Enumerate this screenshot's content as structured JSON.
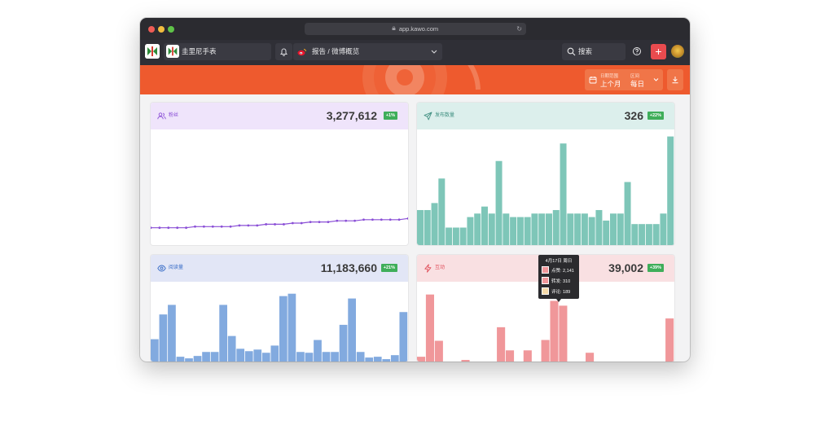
{
  "browser": {
    "url": "app.kawo.com",
    "lights": [
      "#ee5c55",
      "#f2bd3f",
      "#5fc348"
    ]
  },
  "nav": {
    "account_name": "圭里尼手表",
    "report_label": "报告 / 微博概览",
    "search_label": "搜索",
    "plus_label": "+"
  },
  "banner": {
    "date_range_caption": "日期范围",
    "date_range_value": "上个月",
    "interval_caption": "区间",
    "interval_value": "每日"
  },
  "cards": {
    "followers": {
      "label": "粉丝",
      "value": "3,277,612",
      "change": "+1%",
      "color": "#8a4fd6",
      "bg": "#efe4fb",
      "icon": "users-icon"
    },
    "posts": {
      "label": "发布数量",
      "value": "326",
      "change": "+22%",
      "color": "#3f8f80",
      "bg": "#dcefec",
      "icon": "send-icon"
    },
    "views": {
      "label": "阅读量",
      "value": "11,183,660",
      "change": "+21%",
      "color": "#3b6fc8",
      "bg": "#e2e6f6",
      "icon": "eye-icon"
    },
    "engagement": {
      "label": "互动",
      "value": "39,002",
      "change": "+39%",
      "color": "#e04e5a",
      "bg": "#f9e0e2",
      "icon": "bolt-icon"
    }
  },
  "tooltip": {
    "title": "4月17日 周日",
    "rows": [
      {
        "text": "点赞: 2,141",
        "color": "#f0979a"
      },
      {
        "text": "转发: 310",
        "color": "#f0979a"
      },
      {
        "text": "评论: 189",
        "color": "#f5d9a8"
      }
    ]
  },
  "chart_data": [
    {
      "type": "line",
      "series": [
        {
          "values": [
            0.15,
            0.15,
            0.15,
            0.15,
            0.15,
            0.16,
            0.16,
            0.16,
            0.16,
            0.16,
            0.17,
            0.17,
            0.17,
            0.18,
            0.18,
            0.18,
            0.19,
            0.19,
            0.2,
            0.2,
            0.2,
            0.21,
            0.21,
            0.21,
            0.22,
            0.22,
            0.22,
            0.22,
            0.22,
            0.23
          ],
          "color": "#8a4fd6"
        }
      ]
    },
    {
      "type": "bar",
      "series": [
        {
          "values": [
            10,
            10,
            12,
            19,
            5,
            5,
            5,
            8,
            9,
            11,
            9,
            24,
            9,
            8,
            8,
            8,
            9,
            9,
            9,
            10,
            29,
            9,
            9,
            9,
            8,
            10,
            7,
            9,
            9,
            18,
            6,
            6,
            6,
            6,
            9,
            31
          ],
          "color": "#7ec6b8"
        }
      ]
    },
    {
      "type": "bar",
      "series": [
        {
          "values": [
            0.28,
            0.59,
            0.71,
            0.06,
            0.04,
            0.07,
            0.12,
            0.12,
            0.71,
            0.32,
            0.16,
            0.13,
            0.15,
            0.11,
            0.2,
            0.82,
            0.85,
            0.12,
            0.11,
            0.27,
            0.12,
            0.12,
            0.46,
            0.79,
            0.12,
            0.05,
            0.06,
            0.03,
            0.08,
            0.62
          ],
          "color": "#82aadf"
        }
      ]
    },
    {
      "type": "bar",
      "series": [
        {
          "values": [
            0.06,
            0.84,
            0.26,
            0.0,
            0.0,
            0.02,
            0.0,
            0.0,
            0.0,
            0.43,
            0.14,
            0.0,
            0.14,
            0.0,
            0.27,
            0.76,
            0.7,
            0.0,
            0.0,
            0.11,
            0.0,
            0.0,
            0.0,
            0.0,
            0.0,
            0.0,
            0.0,
            0.0,
            0.54
          ],
          "color": "#f0979a"
        }
      ]
    }
  ]
}
